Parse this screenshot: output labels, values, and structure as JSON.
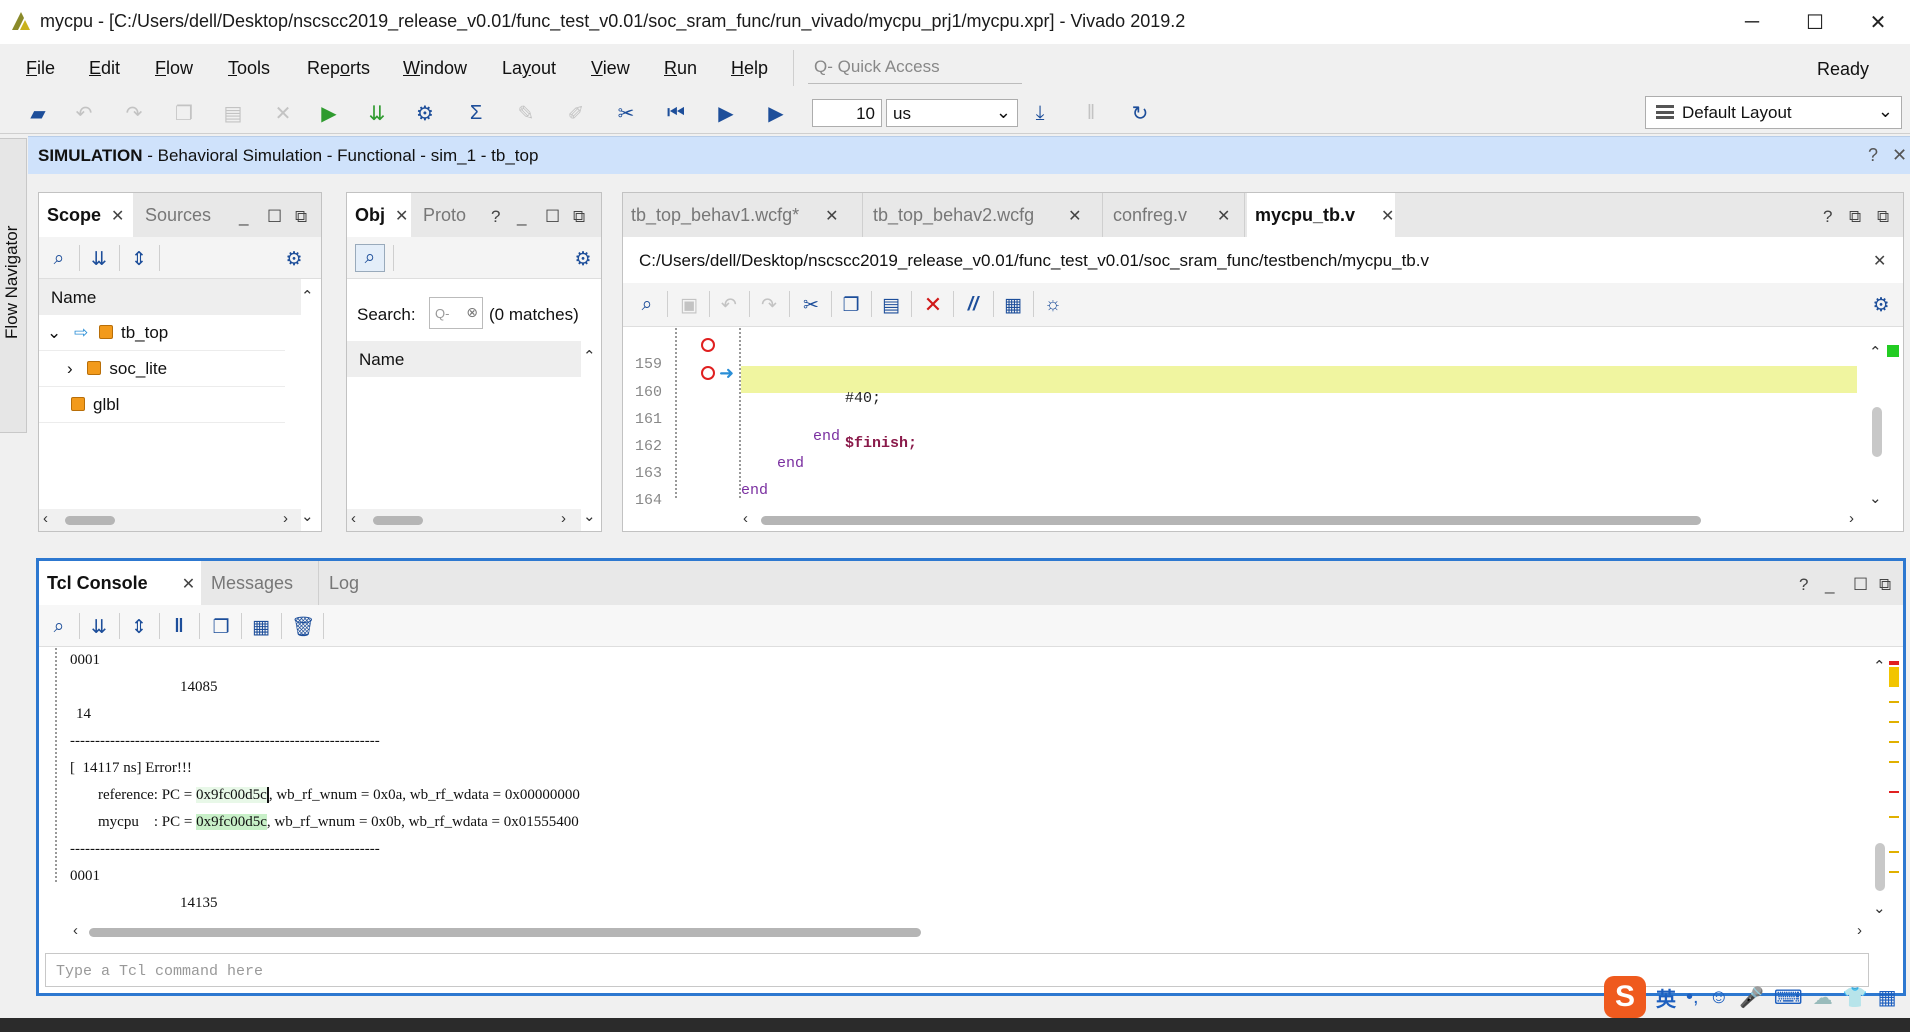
{
  "window": {
    "title": "mycpu - [C:/Users/dell/Desktop/nscscc2019_release_v0.01/func_test_v0.01/soc_sram_func/run_vivado/mycpu_prj1/mycpu.xpr] - Vivado 2019.2",
    "minimize": "─",
    "maximize": "☐",
    "close": "✕"
  },
  "menu": {
    "file": {
      "u": "F",
      "rest": "ile"
    },
    "edit": {
      "u": "E",
      "rest": "dit"
    },
    "flow": {
      "u": "F",
      "rest": "low"
    },
    "tools": {
      "u": "T",
      "rest": "ools"
    },
    "reports": {
      "pre": "Rep",
      "u": "o",
      "rest": "rts"
    },
    "window": {
      "u": "W",
      "rest": "indow"
    },
    "layout": {
      "pre": "La",
      "u": "y",
      "rest": "out"
    },
    "view": {
      "u": "V",
      "rest": "iew"
    },
    "run": {
      "u": "R",
      "rest": "un"
    },
    "help": {
      "u": "H",
      "rest": "elp"
    },
    "quick_access_placeholder": "Q- Quick Access",
    "status": "Ready"
  },
  "toolbar": {
    "time_value": "10",
    "time_unit": "us",
    "layout": "Default Layout"
  },
  "flow_navigator": {
    "label": "Flow Navigator"
  },
  "simulation": {
    "bold": "SIMULATION",
    "rest": " - Behavioral Simulation - Functional - sim_1 - tb_top",
    "help": "?",
    "close": "✕"
  },
  "scope_panel": {
    "tabs": [
      "Scope",
      "Sources"
    ],
    "column": "Name",
    "rows": [
      {
        "label": "tb_top",
        "expander": "⌄"
      },
      {
        "label": "soc_lite",
        "expander": "›"
      },
      {
        "label": "glbl",
        "expander": ""
      }
    ]
  },
  "objects_panel": {
    "tabs": [
      "Obj",
      "Proto"
    ],
    "search_label": "Search:",
    "search_placeholder": "Q-",
    "matches": "(0 matches)",
    "column": "Name"
  },
  "editor": {
    "tabs": [
      {
        "label": "tb_top_behav1.wcfg*",
        "active": false
      },
      {
        "label": "tb_top_behav2.wcfg",
        "active": false
      },
      {
        "label": "confreg.v",
        "active": false
      },
      {
        "label": "mycpu_tb.v",
        "active": true
      }
    ],
    "path": "C:/Users/dell/Desktop/nscscc2019_release_v0.01/func_test_v0.01/soc_sram_func/testbench/mycpu_tb.v",
    "lines": [
      {
        "num": "159",
        "code": "#40;",
        "indent": 90
      },
      {
        "num": "160",
        "code": "$finish;",
        "indent": 90
      },
      {
        "num": "161",
        "code": "end",
        "indent": 60
      },
      {
        "num": "162",
        "code": "end",
        "indent": 30
      },
      {
        "num": "163",
        "code": "end",
        "indent": 0
      },
      {
        "num": "164",
        "code": "",
        "indent": 0
      }
    ]
  },
  "console": {
    "tabs": [
      "Tcl Console",
      "Messages",
      "Log"
    ],
    "lines": {
      "l1": "0001",
      "l2": "14085",
      "l3": "14",
      "l4": "--------------------------------------------------------------",
      "l5": "[  14117 ns] Error!!!",
      "l6a": "reference: PC = ",
      "l6b": "0x9fc00d5c",
      "l6c": ", wb_rf_wnum = 0x0a, wb_rf_wdata = 0x00000000",
      "l7a": "mycpu    : PC = ",
      "l7b": "0x9fc00d5c",
      "l7c": ", wb_rf_wnum = 0x0b, wb_rf_wdata = 0x01555400",
      "l8": "--------------------------------------------------------------",
      "l9": "0001",
      "l10": "14135"
    },
    "input_placeholder": "Type a Tcl command here"
  },
  "ime": {
    "logo": "S",
    "lang": "英"
  }
}
